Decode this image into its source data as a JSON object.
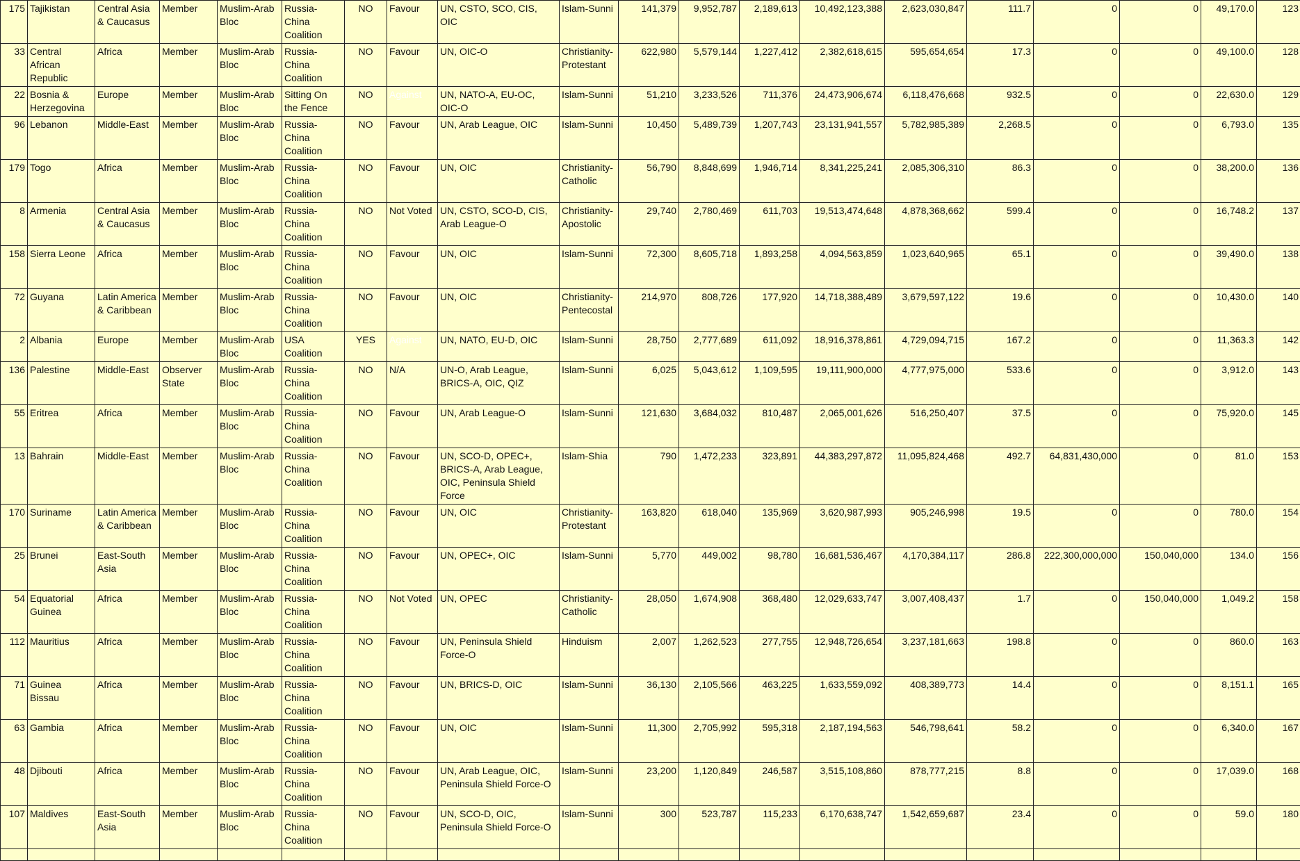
{
  "rows": [
    {
      "id": "175",
      "country": "Tajikistan",
      "region": "Central Asia & Caucasus",
      "status": "Member",
      "bloc": "Muslim-Arab Bloc",
      "coalition": "Russia-China Coalition",
      "flag": "NO",
      "vote": "Favour",
      "orgs": "UN, CSTO, SCO, CIS, OIC",
      "religion": "Islam-Sunni",
      "area": "141,379",
      "pop": "9,952,787",
      "pop2": "2,189,613",
      "gdp": "10,492,123,388",
      "gdp2": "2,623,030,847",
      "density": "111.7",
      "v1": "0",
      "v2": "0",
      "v3": "49,170.0",
      "rank": "123"
    },
    {
      "id": "33",
      "country": "Central African Republic",
      "region": "Africa",
      "status": "Member",
      "bloc": "Muslim-Arab Bloc",
      "coalition": "Russia-China Coalition",
      "flag": "NO",
      "vote": "Favour",
      "orgs": "UN, OIC-O",
      "religion": "Christianity-Protestant",
      "area": "622,980",
      "pop": "5,579,144",
      "pop2": "1,227,412",
      "gdp": "2,382,618,615",
      "gdp2": "595,654,654",
      "density": "17.3",
      "v1": "0",
      "v2": "0",
      "v3": "49,100.0",
      "rank": "128"
    },
    {
      "id": "22",
      "country": "Bosnia & Herzegovina",
      "region": "Europe",
      "status": "Member",
      "bloc": "Muslim-Arab Bloc",
      "coalition": "Sitting On the Fence",
      "flag": "NO",
      "vote": "Against",
      "orgs": "UN, NATO-A, EU-OC, OIC-O",
      "religion": "Islam-Sunni",
      "area": "51,210",
      "pop": "3,233,526",
      "pop2": "711,376",
      "gdp": "24,473,906,674",
      "gdp2": "6,118,476,668",
      "density": "932.5",
      "v1": "0",
      "v2": "0",
      "v3": "22,630.0",
      "rank": "129"
    },
    {
      "id": "96",
      "country": "Lebanon",
      "region": "Middle-East",
      "status": "Member",
      "bloc": "Muslim-Arab Bloc",
      "coalition": "Russia-China Coalition",
      "flag": "NO",
      "vote": "Favour",
      "orgs": "UN, Arab League, OIC",
      "religion": "Islam-Sunni",
      "area": "10,450",
      "pop": "5,489,739",
      "pop2": "1,207,743",
      "gdp": "23,131,941,557",
      "gdp2": "5,782,985,389",
      "density": "2,268.5",
      "v1": "0",
      "v2": "0",
      "v3": "6,793.0",
      "rank": "135"
    },
    {
      "id": "179",
      "country": "Togo",
      "region": "Africa",
      "status": "Member",
      "bloc": "Muslim-Arab Bloc",
      "coalition": "Russia-China Coalition",
      "flag": "NO",
      "vote": "Favour",
      "orgs": "UN, OIC",
      "religion": "Christianity-Catholic",
      "area": "56,790",
      "pop": "8,848,699",
      "pop2": "1,946,714",
      "gdp": "8,341,225,241",
      "gdp2": "2,085,306,310",
      "density": "86.3",
      "v1": "0",
      "v2": "0",
      "v3": "38,200.0",
      "rank": "136"
    },
    {
      "id": "8",
      "country": "Armenia",
      "region": "Central Asia & Caucasus",
      "status": "Member",
      "bloc": "Muslim-Arab Bloc",
      "coalition": "Russia-China Coalition",
      "flag": "NO",
      "vote": "Not Voted",
      "orgs": "UN, CSTO, SCO-D, CIS, Arab League-O",
      "religion": "Christianity-Apostolic",
      "area": "29,740",
      "pop": "2,780,469",
      "pop2": "611,703",
      "gdp": "19,513,474,648",
      "gdp2": "4,878,368,662",
      "density": "599.4",
      "v1": "0",
      "v2": "0",
      "v3": "16,748.2",
      "rank": "137"
    },
    {
      "id": "158",
      "country": "Sierra Leone",
      "region": "Africa",
      "status": "Member",
      "bloc": "Muslim-Arab Bloc",
      "coalition": "Russia-China Coalition",
      "flag": "NO",
      "vote": "Favour",
      "orgs": "UN, OIC",
      "religion": "Islam-Sunni",
      "area": "72,300",
      "pop": "8,605,718",
      "pop2": "1,893,258",
      "gdp": "4,094,563,859",
      "gdp2": "1,023,640,965",
      "density": "65.1",
      "v1": "0",
      "v2": "0",
      "v3": "39,490.0",
      "rank": "138"
    },
    {
      "id": "72",
      "country": "Guyana",
      "region": "Latin America & Caribbean",
      "status": "Member",
      "bloc": "Muslim-Arab Bloc",
      "coalition": "Russia-China Coalition",
      "flag": "NO",
      "vote": "Favour",
      "orgs": "UN, OIC",
      "religion": "Christianity-Pentecostal",
      "area": "214,970",
      "pop": "808,726",
      "pop2": "177,920",
      "gdp": "14,718,388,489",
      "gdp2": "3,679,597,122",
      "density": "19.6",
      "v1": "0",
      "v2": "0",
      "v3": "10,430.0",
      "rank": "140"
    },
    {
      "id": "2",
      "country": "Albania",
      "region": "Europe",
      "status": "Member",
      "bloc": "Muslim-Arab Bloc",
      "coalition": "USA Coalition",
      "flag": "YES",
      "vote": "Against",
      "orgs": "UN, NATO, EU-D, OIC",
      "religion": "Islam-Sunni",
      "area": "28,750",
      "pop": "2,777,689",
      "pop2": "611,092",
      "gdp": "18,916,378,861",
      "gdp2": "4,729,094,715",
      "density": "167.2",
      "v1": "0",
      "v2": "0",
      "v3": "11,363.3",
      "rank": "142"
    },
    {
      "id": "136",
      "country": "Palestine",
      "region": "Middle-East",
      "status": "Observer State",
      "bloc": "Muslim-Arab Bloc",
      "coalition": "Russia-China Coalition",
      "flag": "NO",
      "vote": "N/A",
      "orgs": "UN-O, Arab League, BRICS-A, OIC, QIZ",
      "religion": "Islam-Sunni",
      "area": "6,025",
      "pop": "5,043,612",
      "pop2": "1,109,595",
      "gdp": "19,111,900,000",
      "gdp2": "4,777,975,000",
      "density": "533.6",
      "v1": "0",
      "v2": "0",
      "v3": "3,912.0",
      "rank": "143"
    },
    {
      "id": "55",
      "country": "Eritrea",
      "region": "Africa",
      "status": "Member",
      "bloc": "Muslim-Arab Bloc",
      "coalition": "Russia-China Coalition",
      "flag": "NO",
      "vote": "Favour",
      "orgs": "UN, Arab League-O",
      "religion": "Islam-Sunni",
      "area": "121,630",
      "pop": "3,684,032",
      "pop2": "810,487",
      "gdp": "2,065,001,626",
      "gdp2": "516,250,407",
      "density": "37.5",
      "v1": "0",
      "v2": "0",
      "v3": "75,920.0",
      "rank": "145"
    },
    {
      "id": "13",
      "country": "Bahrain",
      "region": "Middle-East",
      "status": "Member",
      "bloc": "Muslim-Arab Bloc",
      "coalition": "Russia-China Coalition",
      "flag": "NO",
      "vote": "Favour",
      "orgs": "UN, SCO-D, OPEC+, BRICS-A, Arab League, OIC, Peninsula Shield Force",
      "religion": "Islam-Shia",
      "area": "790",
      "pop": "1,472,233",
      "pop2": "323,891",
      "gdp": "44,383,297,872",
      "gdp2": "11,095,824,468",
      "density": "492.7",
      "v1": "64,831,430,000",
      "v2": "0",
      "v3": "81.0",
      "rank": "153"
    },
    {
      "id": "170",
      "country": "Suriname",
      "region": "Latin America & Caribbean",
      "status": "Member",
      "bloc": "Muslim-Arab Bloc",
      "coalition": "Russia-China Coalition",
      "flag": "NO",
      "vote": "Favour",
      "orgs": "UN, OIC",
      "religion": "Christianity-Protestant",
      "area": "163,820",
      "pop": "618,040",
      "pop2": "135,969",
      "gdp": "3,620,987,993",
      "gdp2": "905,246,998",
      "density": "19.5",
      "v1": "0",
      "v2": "0",
      "v3": "780.0",
      "rank": "154"
    },
    {
      "id": "25",
      "country": "Brunei",
      "region": "East-South Asia",
      "status": "Member",
      "bloc": "Muslim-Arab Bloc",
      "coalition": "Russia-China Coalition",
      "flag": "NO",
      "vote": "Favour",
      "orgs": "UN, OPEC+, OIC",
      "religion": "Islam-Sunni",
      "area": "5,770",
      "pop": "449,002",
      "pop2": "98,780",
      "gdp": "16,681,536,467",
      "gdp2": "4,170,384,117",
      "density": "286.8",
      "v1": "222,300,000,000",
      "v2": "150,040,000",
      "v3": "134.0",
      "rank": "156"
    },
    {
      "id": "54",
      "country": "Equatorial Guinea",
      "region": "Africa",
      "status": "Member",
      "bloc": "Muslim-Arab Bloc",
      "coalition": "Russia-China Coalition",
      "flag": "NO",
      "vote": "Not Voted",
      "orgs": "UN, OPEC",
      "religion": "Christianity-Catholic",
      "area": "28,050",
      "pop": "1,674,908",
      "pop2": "368,480",
      "gdp": "12,029,633,747",
      "gdp2": "3,007,408,437",
      "density": "1.7",
      "v1": "0",
      "v2": "150,040,000",
      "v3": "1,049.2",
      "rank": "158"
    },
    {
      "id": "112",
      "country": "Mauritius",
      "region": "Africa",
      "status": "Member",
      "bloc": "Muslim-Arab Bloc",
      "coalition": "Russia-China Coalition",
      "flag": "NO",
      "vote": "Favour",
      "orgs": "UN, Peninsula Shield Force-O",
      "religion": "Hinduism",
      "area": "2,007",
      "pop": "1,262,523",
      "pop2": "277,755",
      "gdp": "12,948,726,654",
      "gdp2": "3,237,181,663",
      "density": "198.8",
      "v1": "0",
      "v2": "0",
      "v3": "860.0",
      "rank": "163"
    },
    {
      "id": "71",
      "country": "Guinea Bissau",
      "region": "Africa",
      "status": "Member",
      "bloc": "Muslim-Arab Bloc",
      "coalition": "Russia-China Coalition",
      "flag": "NO",
      "vote": "Favour",
      "orgs": "UN, BRICS-D, OIC",
      "religion": "Islam-Sunni",
      "area": "36,130",
      "pop": "2,105,566",
      "pop2": "463,225",
      "gdp": "1,633,559,092",
      "gdp2": "408,389,773",
      "density": "14.4",
      "v1": "0",
      "v2": "0",
      "v3": "8,151.1",
      "rank": "165"
    },
    {
      "id": "63",
      "country": "Gambia",
      "region": "Africa",
      "status": "Member",
      "bloc": "Muslim-Arab Bloc",
      "coalition": "Russia-China Coalition",
      "flag": "NO",
      "vote": "Favour",
      "orgs": "UN, OIC",
      "religion": "Islam-Sunni",
      "area": "11,300",
      "pop": "2,705,992",
      "pop2": "595,318",
      "gdp": "2,187,194,563",
      "gdp2": "546,798,641",
      "density": "58.2",
      "v1": "0",
      "v2": "0",
      "v3": "6,340.0",
      "rank": "167"
    },
    {
      "id": "48",
      "country": "Djibouti",
      "region": "Africa",
      "status": "Member",
      "bloc": "Muslim-Arab Bloc",
      "coalition": "Russia-China Coalition",
      "flag": "NO",
      "vote": "Favour",
      "orgs": "UN, Arab League, OIC, Peninsula Shield Force-O",
      "religion": "Islam-Sunni",
      "area": "23,200",
      "pop": "1,120,849",
      "pop2": "246,587",
      "gdp": "3,515,108,860",
      "gdp2": "878,777,215",
      "density": "8.8",
      "v1": "0",
      "v2": "0",
      "v3": "17,039.0",
      "rank": "168"
    },
    {
      "id": "107",
      "country": "Maldives",
      "region": "East-South Asia",
      "status": "Member",
      "bloc": "Muslim-Arab Bloc",
      "coalition": "Russia-China Coalition",
      "flag": "NO",
      "vote": "Favour",
      "orgs": "UN, SCO-D, OIC, Peninsula Shield Force-O",
      "religion": "Islam-Sunni",
      "area": "300",
      "pop": "523,787",
      "pop2": "115,233",
      "gdp": "6,170,638,747",
      "gdp2": "1,542,659,687",
      "density": "23.4",
      "v1": "0",
      "v2": "0",
      "v3": "59.0",
      "rank": "180"
    }
  ]
}
